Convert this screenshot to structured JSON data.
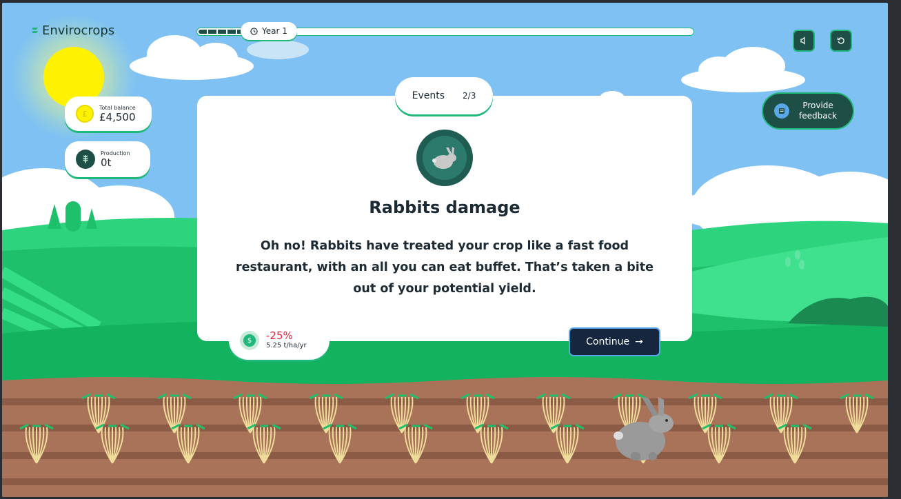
{
  "app": {
    "name": "Envirocrops"
  },
  "progress": {
    "year_label": "Year 1",
    "fraction": 0.1
  },
  "controls": {
    "sound_icon": "speaker-icon",
    "restart_icon": "restart-icon"
  },
  "stats": {
    "balance": {
      "label": "Total balance",
      "value": "£4,500",
      "icon": "coin-icon"
    },
    "production": {
      "label": "Production",
      "value": "0t",
      "icon": "wheat-icon"
    }
  },
  "feedback": {
    "line1": "Provide",
    "line2": "feedback",
    "icon": "document-icon"
  },
  "event": {
    "tab_label": "Events",
    "tab_count": "2/3",
    "icon": "rabbit-icon",
    "title": "Rabbits damage",
    "description": "Oh no! Rabbits have treated your crop like a fast food restaurant, with an all you can eat buffet. That’s taken a bite out of your potential yield.",
    "impact_percent": "-25%",
    "impact_value": "5.25 t/ha/yr",
    "impact_icon": "money-bag-icon",
    "continue_label": "Continue",
    "continue_arrow": "→"
  },
  "colors": {
    "accent": "#1fb87a",
    "dark": "#1d4f47",
    "negative": "#e0293a",
    "button": "#17263f"
  }
}
